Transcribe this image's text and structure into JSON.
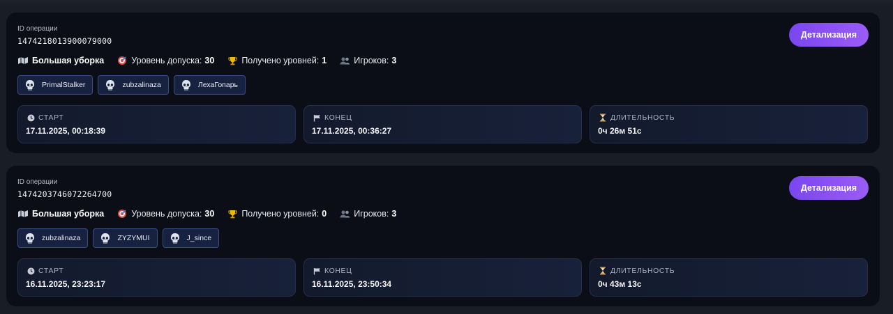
{
  "operations": [
    {
      "id_label": "ID операции",
      "id": "1474218013900079000",
      "detail_label": "Детализация",
      "mode_name": "Большая уборка",
      "access_label": "Уровень допуска:",
      "access_value": "30",
      "levels_label": "Получено уровней:",
      "levels_value": "1",
      "players_label": "Игроков:",
      "players_value": "3",
      "players": [
        "PrimalStalker",
        "zubzalinaza",
        "ЛехаГопарь"
      ],
      "start_label": "СТАРТ",
      "start_value": "17.11.2025, 00:18:39",
      "end_label": "КОНЕЦ",
      "end_value": "17.11.2025, 00:36:27",
      "duration_label": "ДЛИТЕЛЬНОСТЬ",
      "duration_value": "0ч 26м 51с"
    },
    {
      "id_label": "ID операции",
      "id": "1474203746072264700",
      "detail_label": "Детализация",
      "mode_name": "Большая уборка",
      "access_label": "Уровень допуска:",
      "access_value": "30",
      "levels_label": "Получено уровней:",
      "levels_value": "0",
      "players_label": "Игроков:",
      "players_value": "3",
      "players": [
        "zubzalinaza",
        "ZYZYMUI",
        "J_since"
      ],
      "start_label": "СТАРТ",
      "start_value": "16.11.2025, 23:23:17",
      "end_label": "КОНЕЦ",
      "end_value": "16.11.2025, 23:50:34",
      "duration_label": "ДЛИТЕЛЬНОСТЬ",
      "duration_value": "0ч 43м 13с"
    }
  ],
  "icons": {
    "mode": "map-icon",
    "access": "target-icon",
    "levels": "trophy-icon",
    "players": "users-icon",
    "avatar": "skull-avatar-icon",
    "start": "clock-icon",
    "end": "flag-icon",
    "duration": "hourglass-icon"
  },
  "colors": {
    "background": "#191d25",
    "card": "#0b0e16",
    "accent_gradient_start": "#7a46f0",
    "accent_gradient_end": "#9b5cf6",
    "chip_border": "#3a4c86",
    "trophy": "#f2b705"
  }
}
